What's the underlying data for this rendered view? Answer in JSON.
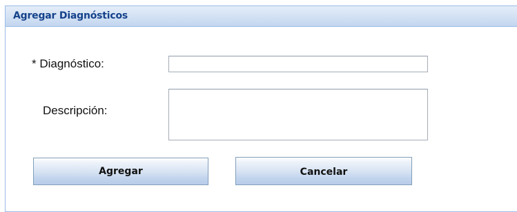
{
  "panel": {
    "title": "Agregar Diagnósticos"
  },
  "form": {
    "diagnostico": {
      "label": "* Diagnóstico:",
      "value": ""
    },
    "descripcion": {
      "label": "Descripción:",
      "value": ""
    }
  },
  "buttons": {
    "agregar": "Agregar",
    "cancelar": "Cancelar"
  },
  "colors": {
    "header_text": "#15428b",
    "panel_border": "#99bbe8",
    "header_bg": "#d6e3f4"
  }
}
